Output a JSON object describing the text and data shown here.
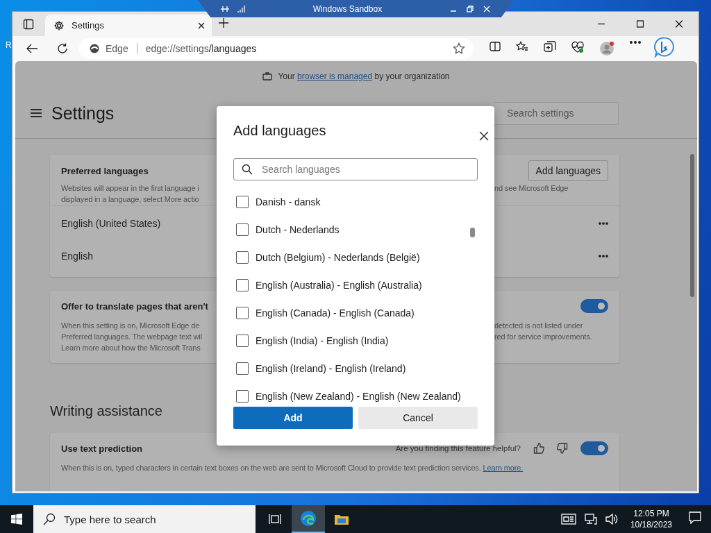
{
  "desktop": {
    "stray_text": "R"
  },
  "sandbox_bar": {
    "title": "Windows Sandbox"
  },
  "browser": {
    "tabs": [
      {
        "label": "Settings",
        "selected": true
      }
    ],
    "address": {
      "site_label": "Edge",
      "url_host": "edge://settings",
      "url_path": "/languages"
    }
  },
  "banner": {
    "text_before": "Your",
    "link": "browser is managed",
    "text_after": "by your organization"
  },
  "settings": {
    "title": "Settings",
    "search_placeholder": "Search settings",
    "preferred": {
      "title": "Preferred languages",
      "button": "Add languages",
      "desc_left": [
        "Websites will appear in the first language i",
        "displayed in a language, select More actio"
      ],
      "desc_right": [
        "nd see Microsoft Edge"
      ],
      "languages": [
        "English (United States)",
        "English"
      ]
    },
    "translate": {
      "title": "Offer to translate pages that aren't",
      "on": true,
      "desc_left": [
        "When this setting is on, Microsoft Edge de",
        "Preferred languages. The webpage text wil",
        "Learn more about how the Microsoft Trans"
      ],
      "desc_right": [
        "detected is not listed under",
        "red for service improvements."
      ]
    },
    "writing": {
      "heading": "Writing assistance",
      "title": "Use text prediction",
      "feedback": "Are you finding this feature helpful?",
      "on": true,
      "desc": "When this is on, typed characters in certain text boxes on the web are sent to Microsoft Cloud to provide text prediction services.",
      "link": "Learn more."
    }
  },
  "dialog": {
    "title": "Add languages",
    "search_placeholder": "Search languages",
    "languages": [
      {
        "label": "Danish - dansk",
        "checked": false
      },
      {
        "label": "Dutch - Nederlands",
        "checked": false
      },
      {
        "label": "Dutch (Belgium) - Nederlands (België)",
        "checked": false
      },
      {
        "label": "English (Australia) - English (Australia)",
        "checked": false
      },
      {
        "label": "English (Canada) - English (Canada)",
        "checked": false
      },
      {
        "label": "English (India) - English (India)",
        "checked": false
      },
      {
        "label": "English (Ireland) - English (Ireland)",
        "checked": false
      },
      {
        "label": "English (New Zealand) - English (New Zealand)",
        "checked": false
      }
    ],
    "buttons": [
      "Add",
      "Cancel"
    ]
  },
  "taskbar": {
    "search_placeholder": "Type here to search",
    "time": "12:05 PM",
    "date": "10/18/2023"
  }
}
